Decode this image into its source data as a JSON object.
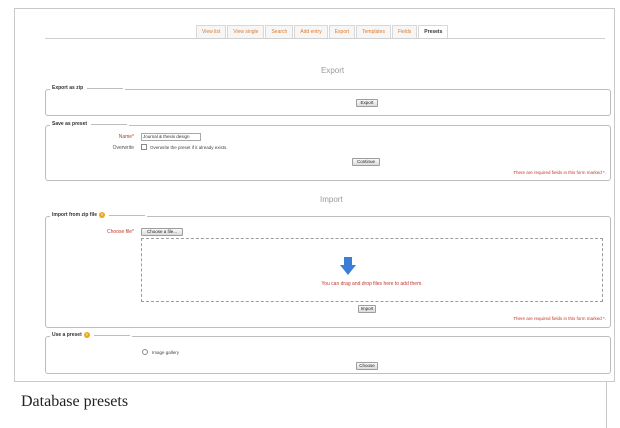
{
  "tabs": [
    {
      "label": "View list",
      "active": false
    },
    {
      "label": "View single",
      "active": false
    },
    {
      "label": "Search",
      "active": false
    },
    {
      "label": "Add entry",
      "active": false
    },
    {
      "label": "Export",
      "active": false
    },
    {
      "label": "Templates",
      "active": false
    },
    {
      "label": "Fields",
      "active": false
    },
    {
      "label": "Presets",
      "active": true
    }
  ],
  "export": {
    "heading": "Export",
    "zip_legend": "Export as zip",
    "export_button": "Export",
    "preset_legend": "Save as preset",
    "name_label": "Name*",
    "name_value": "Journal & thesis design",
    "overwrite_label": "Overwrite",
    "overwrite_text": "Overwrite the preset if it already exists.",
    "continue_button": "Continue",
    "required_note": "There are required fields in this form marked *."
  },
  "import": {
    "heading": "Import",
    "zip_legend": "Import from zip file",
    "choose_label": "Choose file*",
    "choose_button": "Choose a file...",
    "drop_text": "You can drag and drop files here to add them.",
    "import_button": "Import",
    "required_note": "There are required fields in this form marked *."
  },
  "use_preset": {
    "legend": "Use a preset",
    "option_label": "Image gallery",
    "choose_button": "Choose"
  },
  "caption": "Database presets",
  "colors": {
    "accent": "#e07a2a",
    "required": "#c0392b",
    "help": "#e8a81e",
    "arrow": "#3b7dd8"
  }
}
